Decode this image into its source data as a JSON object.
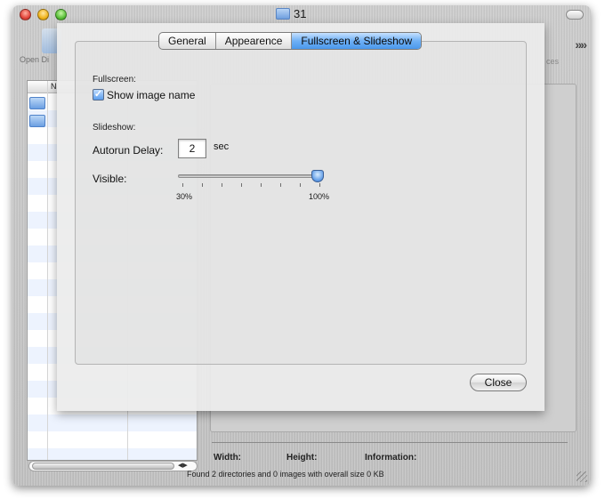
{
  "window": {
    "title": "31",
    "toolbar_open_label": "Open Di",
    "toolbar_right_label": "ces",
    "list_column_name": "N",
    "info": {
      "width_label": "Width:",
      "height_label": "Height:",
      "information_label": "Information:"
    },
    "status": "Found 2 directories and 0 images with overall size 0 KB"
  },
  "prefs": {
    "tabs": [
      {
        "label": "General",
        "active": false
      },
      {
        "label": "Appearence",
        "active": false
      },
      {
        "label": "Fullscreen & Slideshow",
        "active": true
      }
    ],
    "fullscreen_section": "Fullscreen:",
    "show_image_name": {
      "label": "Show image name",
      "checked": true
    },
    "slideshow_section": "Slideshow:",
    "autorun_delay": {
      "label": "Autorun Delay:",
      "value": "2",
      "unit": "sec"
    },
    "visible": {
      "label": "Visible:",
      "min_label": "30%",
      "max_label": "100%",
      "value_percent": 100
    },
    "close_label": "Close"
  },
  "colors": {
    "accent": "#4b98ec",
    "window_metal": "#c4c4c4"
  },
  "icons": {
    "window_title": "folder-icon",
    "toolbar_open": "open-directory-icon",
    "list_rows": "folder-icon"
  }
}
